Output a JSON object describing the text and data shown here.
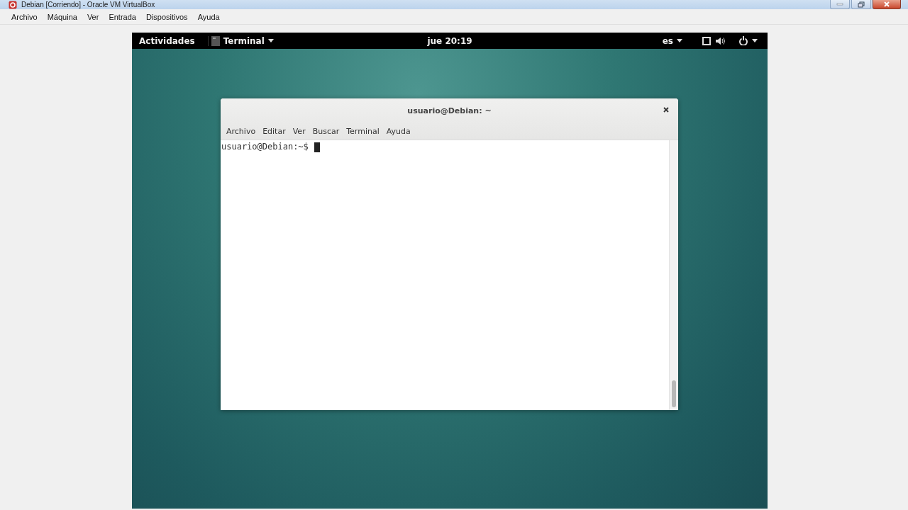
{
  "host_window": {
    "title": "Debian [Corriendo] - Oracle VM VirtualBox",
    "menu": [
      "Archivo",
      "Máquina",
      "Ver",
      "Entrada",
      "Dispositivos",
      "Ayuda"
    ]
  },
  "top_bar": {
    "activities": "Actividades",
    "app_menu": "Terminal",
    "clock": "jue 20:19",
    "input_source": "es"
  },
  "terminal": {
    "title": "usuario@Debian: ~",
    "menu": [
      "Archivo",
      "Editar",
      "Ver",
      "Buscar",
      "Terminal",
      "Ayuda"
    ],
    "prompt": "usuario@Debian:~$"
  }
}
